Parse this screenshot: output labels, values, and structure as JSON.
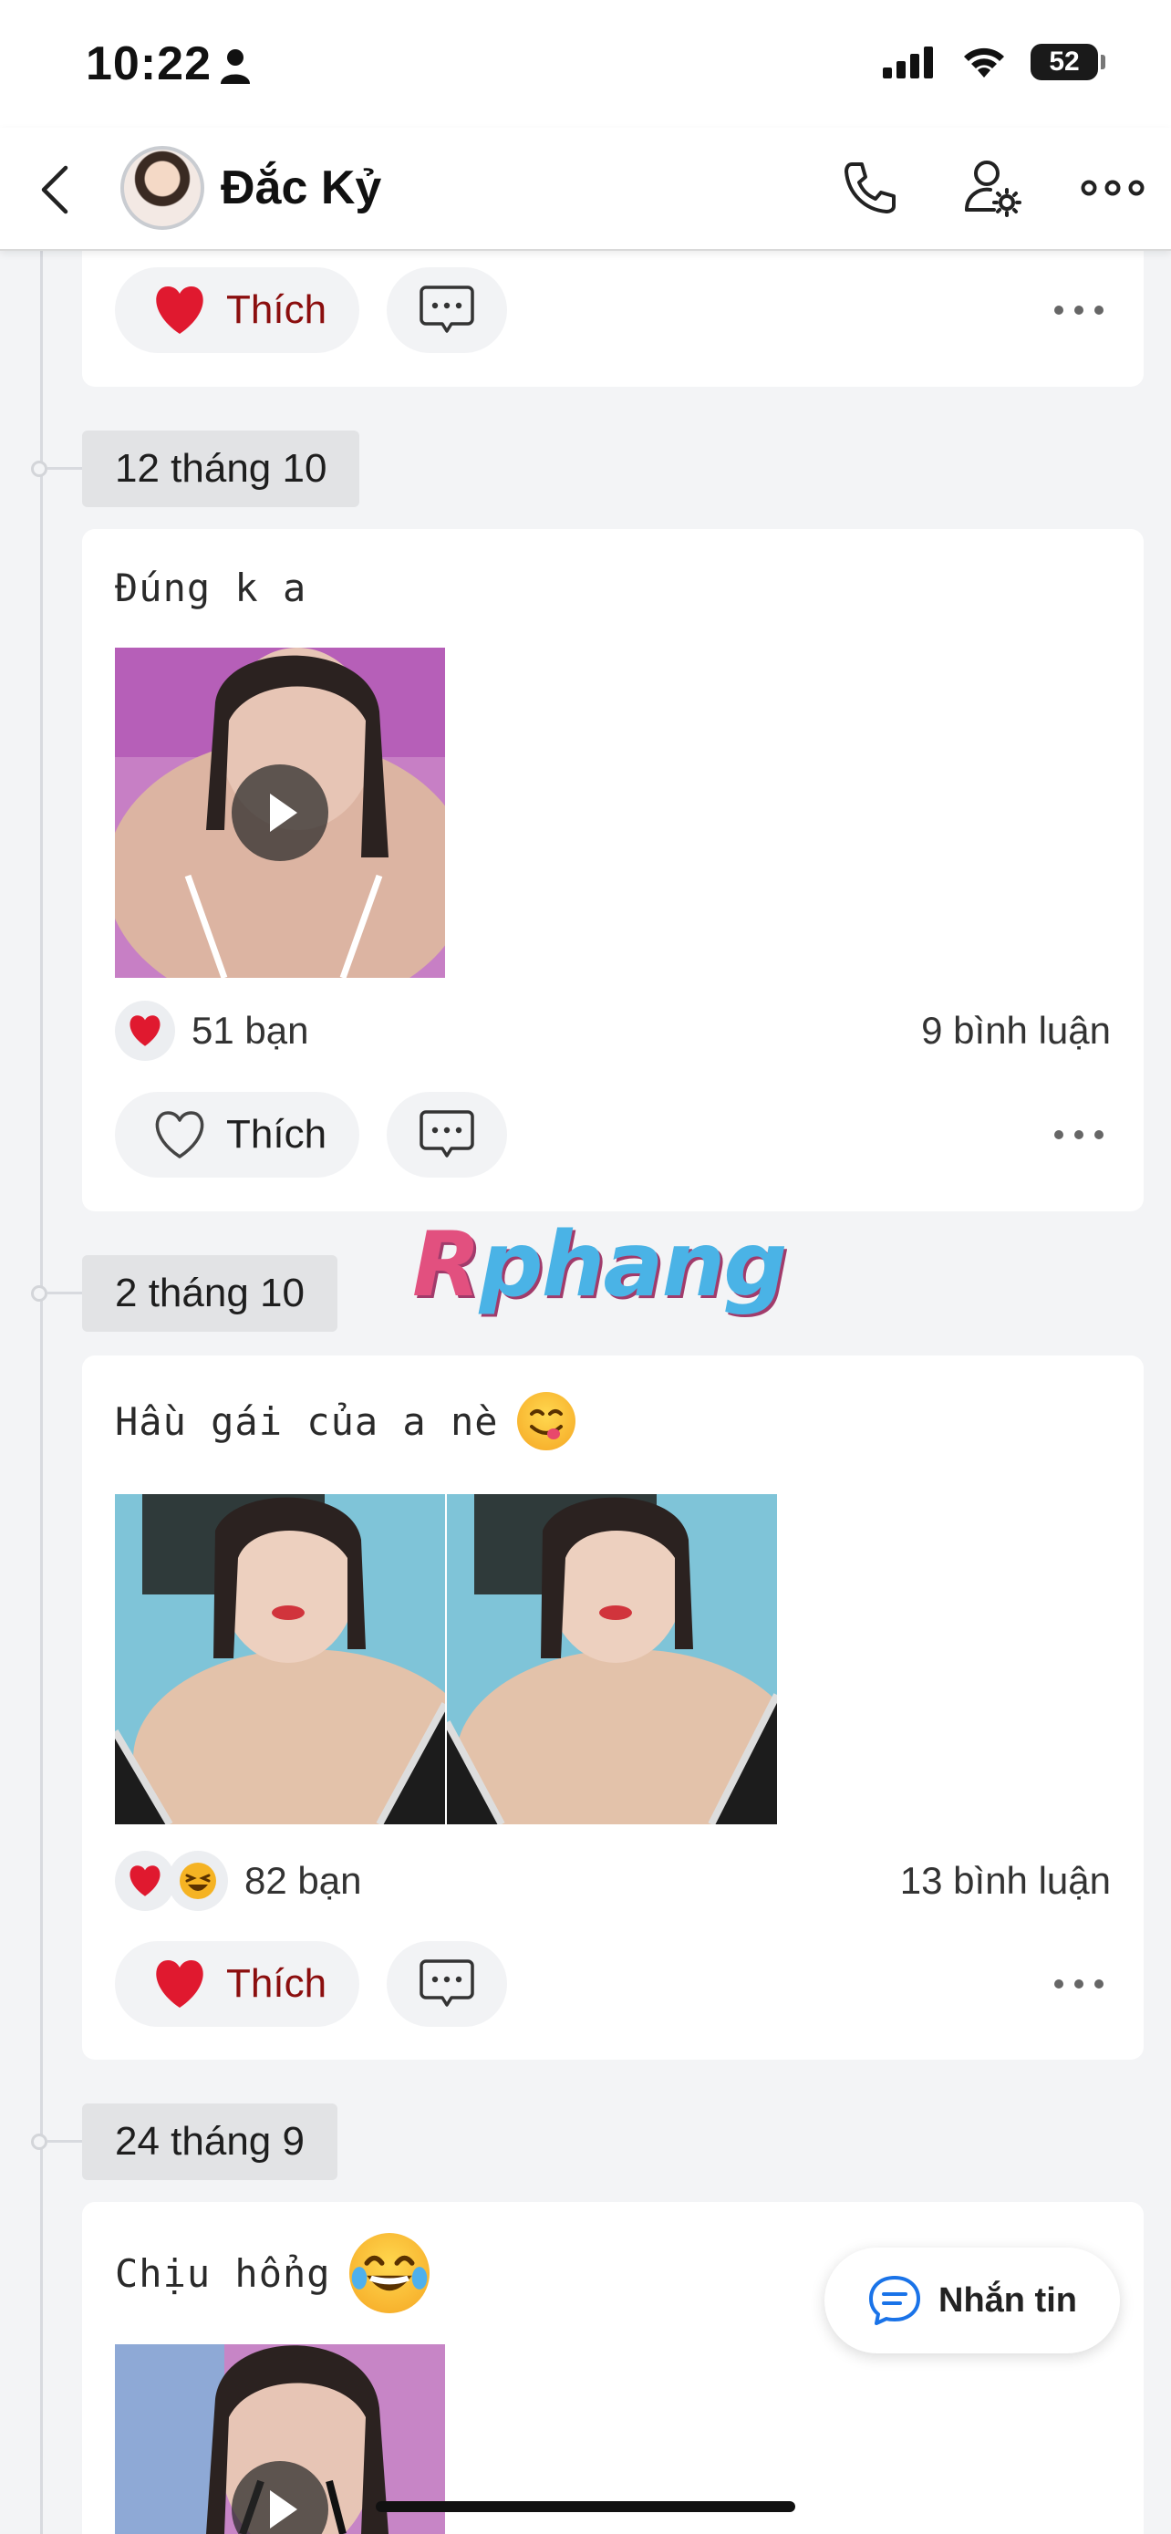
{
  "status_bar": {
    "time": "10:22",
    "battery": "52"
  },
  "header": {
    "name": "Đắc Kỷ"
  },
  "posts": [
    {
      "like_label": "Thích"
    },
    {
      "date": "12 tháng 10",
      "text": "Đúng k a",
      "reactions": "51 bạn",
      "comments": "9 bình luận",
      "like_label": "Thích"
    },
    {
      "date": "2 tháng 10",
      "text": "Hầu gái của a nè",
      "reactions": "82 bạn",
      "comments": "13 bình luận",
      "like_label": "Thích"
    },
    {
      "date": "24 tháng 9",
      "text": "Chịu hổng"
    }
  ],
  "watermark": {
    "r": "R",
    "rest": "phang"
  },
  "message_button": {
    "label": "Nhắn tin"
  },
  "colors": {
    "liked_heart": "#e0192f",
    "liked_text": "#8b0e0e",
    "accent_blue": "#1a73e8"
  }
}
